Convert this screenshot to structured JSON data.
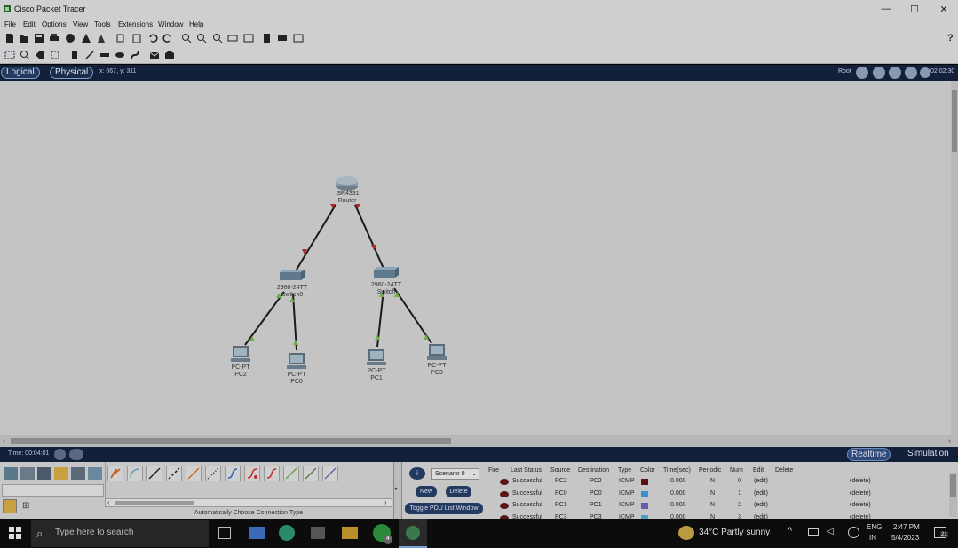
{
  "window": {
    "title": "Cisco Packet Tracer",
    "minimize": "—",
    "maximize": "☐",
    "close": "✕"
  },
  "menu": [
    "File",
    "Edit",
    "Options",
    "View",
    "Tools",
    "Extensions",
    "Window",
    "Help"
  ],
  "help_glyph": "?",
  "viewbar": {
    "logical": "Logical",
    "physical": "Physical",
    "coords": "x: 667, y: 311",
    "root": "Root",
    "clock": "02:02:30"
  },
  "topology": {
    "router": {
      "model": "ISR4331",
      "name": "Router"
    },
    "switch0": {
      "model": "2960-24TT",
      "name": "Switch0"
    },
    "switch1": {
      "model": "2960-24TT",
      "name": "Switch"
    },
    "pc2": {
      "model": "PC-PT",
      "name": "PC2"
    },
    "pc0": {
      "model": "PC-PT",
      "name": "PC0"
    },
    "pc1": {
      "model": "PC-PT",
      "name": "PC1"
    },
    "pc3": {
      "model": "PC-PT",
      "name": "PC3"
    },
    "link_colors": {
      "up": "#6fae4a",
      "down": "#b02a2a"
    }
  },
  "timebar": {
    "time": "Time: 00:04:01",
    "realtime": "Realtime",
    "simulation": "Simulation"
  },
  "bottom": {
    "connection_hint": "Automatically Choose Connection Type",
    "scenario": "Scenario 0",
    "new_btn": "New",
    "delete_btn": "Delete",
    "toggle_btn": "Toggle PDU List Window",
    "pdu_headers": [
      "Fire",
      "Last Status",
      "Source",
      "Destination",
      "Type",
      "Color",
      "Time(sec)",
      "Periodic",
      "Num",
      "Edit",
      "Delete"
    ],
    "pdu_rows": [
      {
        "status": "Successful",
        "source": "PC2",
        "dest": "PC2",
        "type": "ICMP",
        "color": "#5a1010",
        "time": "0.000",
        "periodic": "N",
        "num": "0",
        "edit": "(edit)",
        "delete": "(delete)"
      },
      {
        "status": "Successful",
        "source": "PC0",
        "dest": "PC0",
        "type": "ICMP",
        "color": "#3a90d0",
        "time": "0.000",
        "periodic": "N",
        "num": "1",
        "edit": "(edit)",
        "delete": "(delete)"
      },
      {
        "status": "Successful",
        "source": "PC1",
        "dest": "PC1",
        "type": "ICMP",
        "color": "#6a5aa8",
        "time": "0.000",
        "periodic": "N",
        "num": "2",
        "edit": "(edit)",
        "delete": "(delete)"
      },
      {
        "status": "Successful",
        "source": "PC3",
        "dest": "PC3",
        "type": "ICMP",
        "color": "#4aa0c0",
        "time": "0.000",
        "periodic": "N",
        "num": "3",
        "edit": "(edit)",
        "delete": "(delete)"
      }
    ]
  },
  "taskbar": {
    "search_placeholder": "Type here to search",
    "weather": "34°C  Partly sunny",
    "lang1": "ENG",
    "lang2": "IN",
    "time": "2:47 PM",
    "date": "5/4/2023",
    "notif_count": "21",
    "whatsapp_badge": "4"
  }
}
